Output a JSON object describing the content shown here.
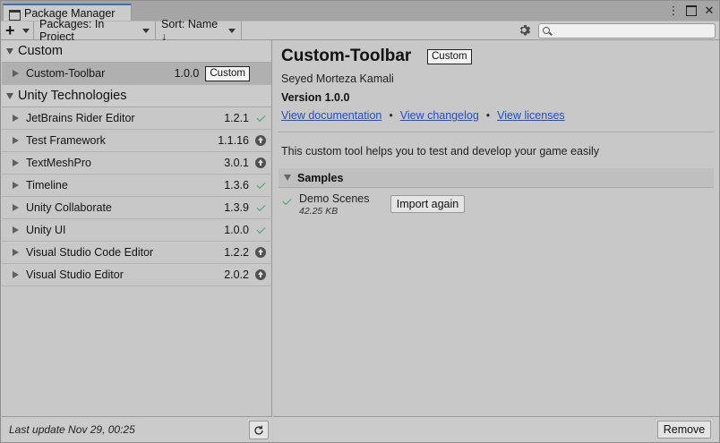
{
  "window": {
    "tab_title": "Package Manager",
    "controls": {
      "more": "⋮",
      "maximize": "",
      "close": "✕"
    }
  },
  "toolbar": {
    "add_label": "+",
    "packages_filter": "Packages: In Project",
    "sort": "Sort: Name ↓",
    "search_placeholder": "",
    "search_value": ""
  },
  "groups": [
    {
      "name": "Custom",
      "packages": [
        {
          "name": "Custom-Toolbar",
          "version": "1.0.0",
          "tag": "Custom",
          "status": "none",
          "selected": true
        }
      ]
    },
    {
      "name": "Unity Technologies",
      "packages": [
        {
          "name": "JetBrains Rider Editor",
          "version": "1.2.1",
          "status": "installed"
        },
        {
          "name": "Test Framework",
          "version": "1.1.16",
          "status": "update"
        },
        {
          "name": "TextMeshPro",
          "version": "3.0.1",
          "status": "update"
        },
        {
          "name": "Timeline",
          "version": "1.3.6",
          "status": "installed"
        },
        {
          "name": "Unity Collaborate",
          "version": "1.3.9",
          "status": "installed"
        },
        {
          "name": "Unity UI",
          "version": "1.0.0",
          "status": "installed"
        },
        {
          "name": "Visual Studio Code Editor",
          "version": "1.2.2",
          "status": "update"
        },
        {
          "name": "Visual Studio Editor",
          "version": "2.0.2",
          "status": "update"
        }
      ]
    }
  ],
  "footer": {
    "last_update": "Last update Nov 29, 00:25"
  },
  "detail": {
    "title": "Custom-Toolbar",
    "tag": "Custom",
    "author": "Seyed Morteza Kamali",
    "version": "Version 1.0.0",
    "links": {
      "documentation": "View documentation",
      "changelog": "View changelog",
      "licenses": "View licenses",
      "separator": "•"
    },
    "description": "This custom tool helps you to test and develop your game easily",
    "samples": {
      "header": "Samples",
      "items": [
        {
          "name": "Demo Scenes",
          "size": "42.25 KB",
          "button": "Import again"
        }
      ]
    },
    "remove_button": "Remove"
  },
  "colors": {
    "link": "#1f4ed0",
    "installed_check": "#39a26a",
    "tab_accent": "#3a72b0"
  }
}
